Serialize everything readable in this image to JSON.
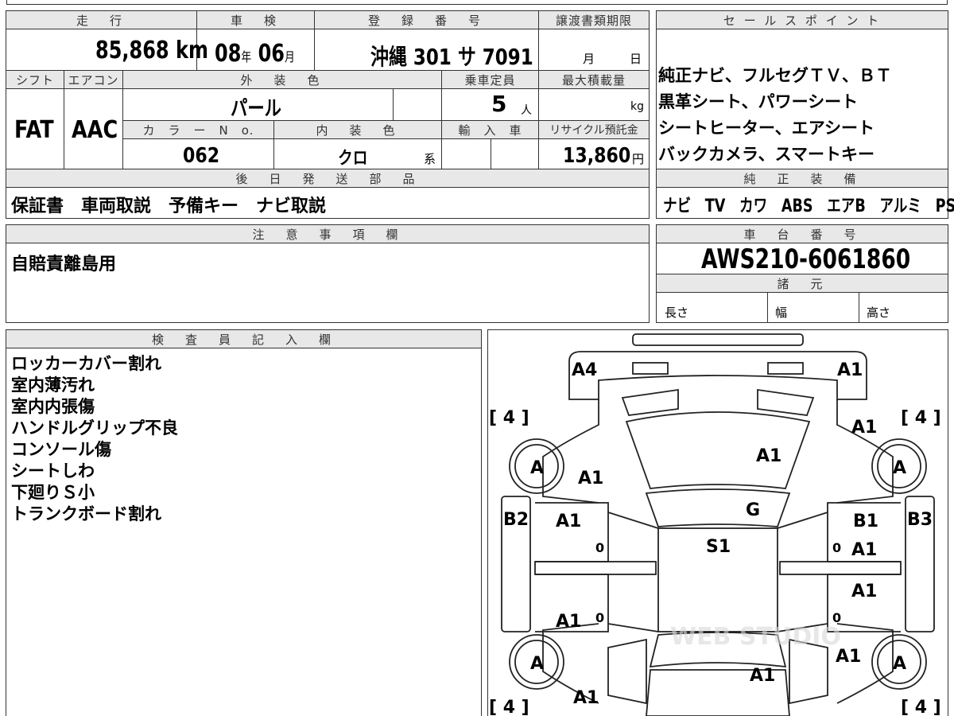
{
  "headers": {
    "mileage": "走　行",
    "inspection": "車　検",
    "reg_number": "登　録　番　号",
    "transfer_deadline": "譲渡書類期限",
    "sales_points": "セ ー ル ス ポ イ ン ト",
    "shift": "シフト",
    "aircon": "エアコン",
    "ext_color": "外　装　色",
    "capacity": "乗車定員",
    "max_load": "最大積載量",
    "color_no": "カ　ラ　ー　N　o.",
    "int_color": "内　装　色",
    "import": "輸　入　車",
    "recycle": "リサイクル預託金",
    "later_parts": "後　日　発　送　部　品",
    "oem_equip": "純　正　装　備",
    "notes": "注　意　事　項　欄",
    "chassis_no": "車　台　番　号",
    "specs": "諸　元",
    "inspector": "検　査　員　記　入　欄"
  },
  "mileage": {
    "value": "85,868",
    "unit": "km"
  },
  "inspection": {
    "year": "08",
    "year_unit": "年",
    "month": "06",
    "month_unit": "月"
  },
  "registration": {
    "value": "沖縄 301 サ 7091"
  },
  "transfer": {
    "month_unit": "月",
    "day_unit": "日"
  },
  "sales_points": [
    "純正ナビ、フルセグＴＶ、ＢＴ",
    "黒革シート、パワーシート",
    "シートヒーター、エアシート",
    "バックカメラ、スマートキー"
  ],
  "shift": "FAT",
  "aircon": "AAC",
  "ext_color": "パール",
  "capacity": {
    "value": "5",
    "unit": "人"
  },
  "max_load": {
    "unit": "kg"
  },
  "color_no": "062",
  "int_color": {
    "value": "クロ",
    "suffix": "系"
  },
  "recycle": {
    "value": "13,860",
    "unit": "円"
  },
  "later_parts": "保証書　車両取説　予備キー　ナビ取説",
  "oem_equipment": "ナビ　TV　カワ　ABS　エアB　アルミ　PS　PW",
  "notes_text": "自賠責離島用",
  "chassis_no": "AWS210-6061860",
  "specs": {
    "length": "長さ",
    "width": "幅",
    "height": "高さ"
  },
  "inspector_notes": [
    "ロッカーカバー割れ",
    "室内薄汚れ",
    "室内内張傷",
    "ハンドルグリップ不良",
    "コンソール傷",
    "シートしわ",
    "下廻りＳ小",
    "トランクボード割れ"
  ],
  "diagram_marks": {
    "front_left_corner": "A4",
    "front_right_corner": "A1",
    "tire_fl": "[ 4 ]",
    "tire_fr": "[ 4 ]",
    "tire_rl": "[ 4 ]",
    "tire_rr": "[ 4 ]",
    "wheel": "A",
    "hood": "A1",
    "right_fender": "A1",
    "left_fender": "A1",
    "windshield": "G",
    "left_pillar": "B2",
    "right_pillar": "B3",
    "right_b": "B1",
    "roof": "S1",
    "lf_door": "A1",
    "lr_door": "A1",
    "rf_door": "A1",
    "rr_door": "A1",
    "right_quarter": "A1",
    "trunk": "A1",
    "left_rear": "A1",
    "zero": "0"
  },
  "watermark": "WEB STUDIO"
}
